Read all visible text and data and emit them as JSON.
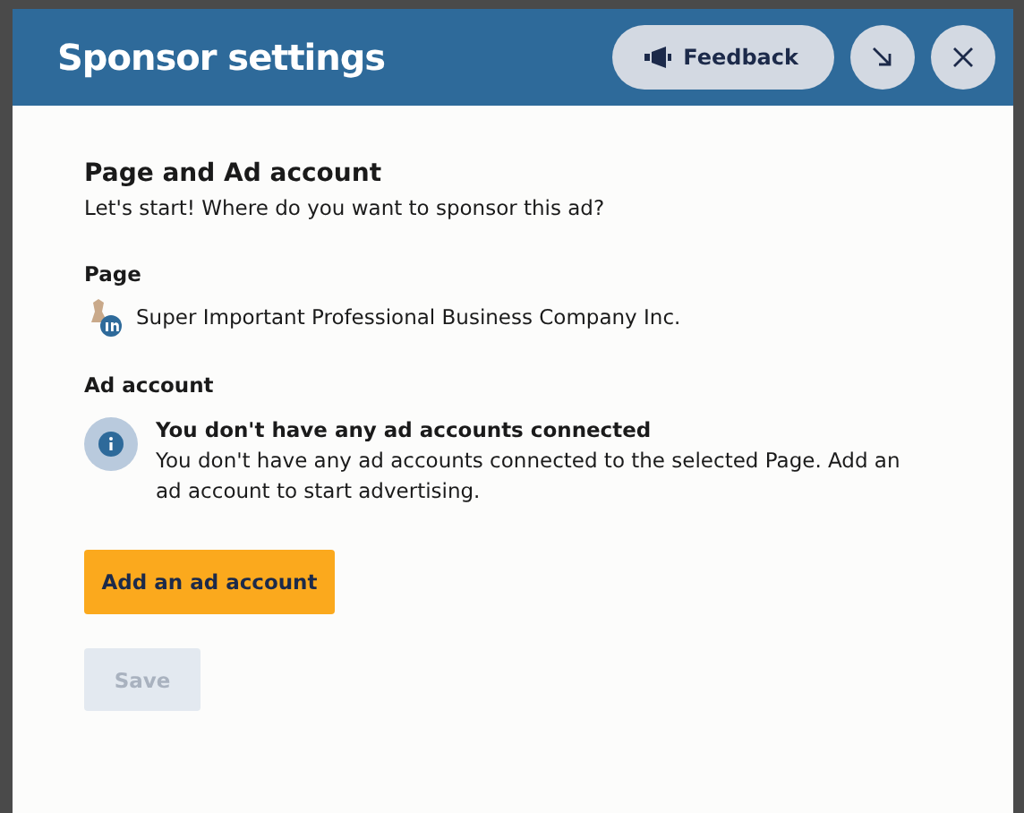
{
  "dialog": {
    "title": "Sponsor settings",
    "feedback_button": "Feedback"
  },
  "section": {
    "heading": "Page and Ad account",
    "subtitle": "Let's start! Where do you want to sponsor this ad?"
  },
  "page": {
    "label": "Page",
    "name": "Super Important Professional Business Company Inc."
  },
  "ad_account": {
    "label": "Ad account",
    "notice_title": "You don't have any ad accounts connected",
    "notice_body": "You don't have any ad accounts connected to the selected Page. Add an ad account to start advertising."
  },
  "add_button": "Add an ad account",
  "save_button": {
    "label": "Save",
    "disabled": true
  }
}
